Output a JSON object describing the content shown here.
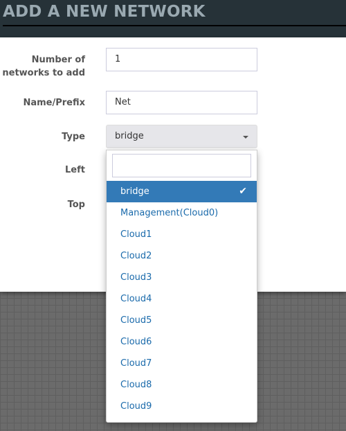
{
  "title": "ADD A NEW NETWORK",
  "form": {
    "count_label": "Number of networks to add",
    "count_value": "1",
    "name_label": "Name/Prefix",
    "name_value": "Net",
    "type_label": "Type",
    "type_value": "bridge",
    "left_label": "Left",
    "top_label": "Top"
  },
  "dropdown": {
    "search_value": "",
    "options": [
      "bridge",
      "Management(Cloud0)",
      "Cloud1",
      "Cloud2",
      "Cloud3",
      "Cloud4",
      "Cloud5",
      "Cloud6",
      "Cloud7",
      "Cloud8",
      "Cloud9"
    ],
    "selected": "bridge",
    "check": "✔"
  }
}
